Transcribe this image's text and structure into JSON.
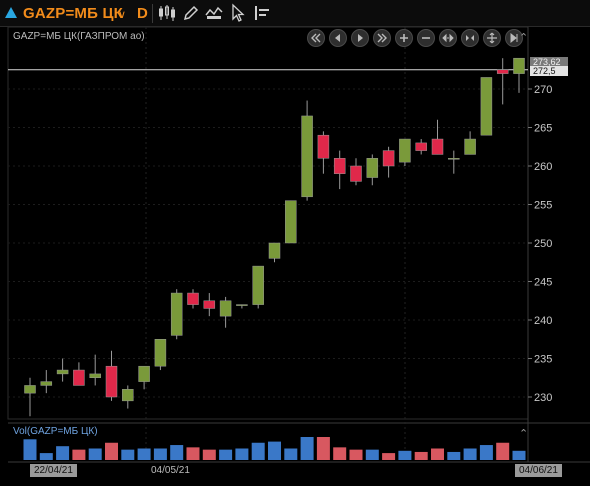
{
  "toolbar": {
    "symbol": "GAZP=МБ ЦК",
    "period": "D"
  },
  "chart_title": "GAZP=МБ ЦК(ГАЗПРОМ ао)",
  "volume_title": "Vol(GAZP=МБ ЦК)",
  "price_tags": {
    "upper": "273,62",
    "lower": "272,5"
  },
  "x_labels": {
    "start": "22/04/21",
    "middle": "04/05/21",
    "end": "04/06/21"
  },
  "colors": {
    "up": "#7a9a3a",
    "down": "#e0284a",
    "vol_up": "#3a78c8",
    "vol_down": "#d85860",
    "accent": "#f28c1b"
  },
  "chart_data": {
    "type": "candlestick",
    "yaxis_ticks": [
      230,
      235,
      240,
      245,
      250,
      255,
      260,
      265,
      270
    ],
    "ylim": [
      227,
      274
    ],
    "current_price_line": 272.5,
    "candles": [
      {
        "o": 230.5,
        "h": 232.5,
        "l": 227.5,
        "c": 231.5
      },
      {
        "o": 231.5,
        "h": 233.5,
        "l": 230.5,
        "c": 232
      },
      {
        "o": 233,
        "h": 235,
        "l": 232,
        "c": 233.5
      },
      {
        "o": 233.5,
        "h": 234.5,
        "l": 231.5,
        "c": 231.5
      },
      {
        "o": 232.5,
        "h": 235.5,
        "l": 231.5,
        "c": 233
      },
      {
        "o": 234,
        "h": 236,
        "l": 229.5,
        "c": 230
      },
      {
        "o": 229.5,
        "h": 231.5,
        "l": 228.5,
        "c": 231
      },
      {
        "o": 232,
        "h": 234,
        "l": 231,
        "c": 234
      },
      {
        "o": 234,
        "h": 237.5,
        "l": 233.5,
        "c": 237.5
      },
      {
        "o": 238,
        "h": 244,
        "l": 237.5,
        "c": 243.5
      },
      {
        "o": 243.5,
        "h": 244,
        "l": 241.5,
        "c": 242
      },
      {
        "o": 242.5,
        "h": 243.5,
        "l": 240.5,
        "c": 241.5
      },
      {
        "o": 240.5,
        "h": 243,
        "l": 239,
        "c": 242.5
      },
      {
        "o": 242,
        "h": 242,
        "l": 241.5,
        "c": 242
      },
      {
        "o": 242,
        "h": 247,
        "l": 241.5,
        "c": 247
      },
      {
        "o": 248,
        "h": 250,
        "l": 247.5,
        "c": 250
      },
      {
        "o": 250,
        "h": 255.5,
        "l": 250,
        "c": 255.5
      },
      {
        "o": 256,
        "h": 268.5,
        "l": 255.5,
        "c": 266.5
      },
      {
        "o": 264,
        "h": 264.5,
        "l": 259,
        "c": 261
      },
      {
        "o": 261,
        "h": 262,
        "l": 257,
        "c": 259
      },
      {
        "o": 260,
        "h": 261,
        "l": 257.5,
        "c": 258
      },
      {
        "o": 258.5,
        "h": 261.5,
        "l": 257.5,
        "c": 261
      },
      {
        "o": 262,
        "h": 262.5,
        "l": 258.5,
        "c": 260
      },
      {
        "o": 260.5,
        "h": 263.5,
        "l": 260,
        "c": 263.5
      },
      {
        "o": 263,
        "h": 263.5,
        "l": 261.5,
        "c": 262
      },
      {
        "o": 263.5,
        "h": 266,
        "l": 261.5,
        "c": 261.5
      },
      {
        "o": 261,
        "h": 262,
        "l": 259,
        "c": 261
      },
      {
        "o": 261.5,
        "h": 264.5,
        "l": 261.5,
        "c": 263.5
      },
      {
        "o": 264,
        "h": 271.5,
        "l": 264,
        "c": 271.5
      },
      {
        "o": 272.5,
        "h": 274,
        "l": 268,
        "c": 272
      },
      {
        "o": 272,
        "h": 274,
        "l": 269.5,
        "c": 274
      }
    ],
    "volume": [
      0.9,
      0.3,
      0.6,
      0.45,
      0.5,
      0.75,
      0.45,
      0.5,
      0.5,
      0.65,
      0.55,
      0.45,
      0.45,
      0.5,
      0.75,
      0.8,
      0.5,
      1.0,
      1.0,
      0.55,
      0.45,
      0.45,
      0.3,
      0.4,
      0.35,
      0.5,
      0.35,
      0.5,
      0.65,
      0.75,
      0.4
    ]
  }
}
